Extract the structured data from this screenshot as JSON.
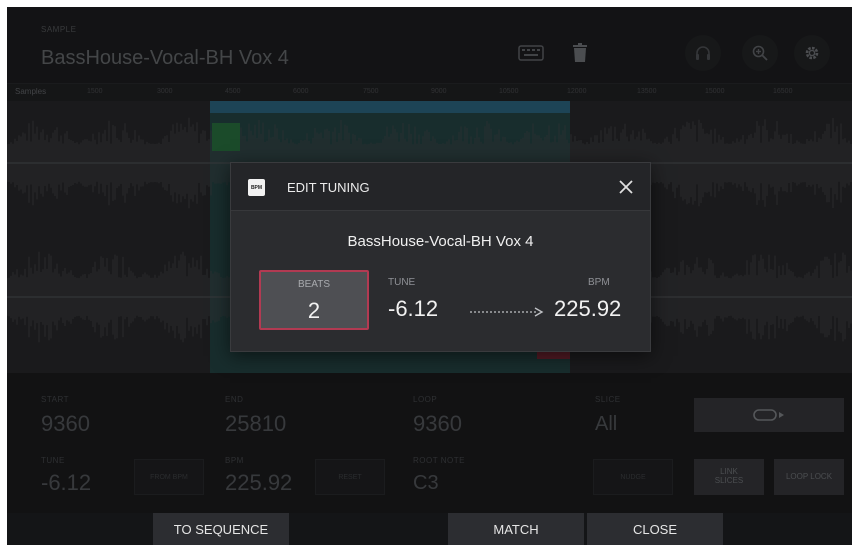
{
  "header": {
    "sample_label": "SAMPLE",
    "sample_name": "BassHouse-Vocal-BH Vox 4",
    "icons": [
      "keyboard-icon",
      "trash-icon",
      "headphones-icon",
      "zoom-icon",
      "gear-icon"
    ]
  },
  "ruler": {
    "mode": "Samples",
    "ticks": [
      "1500",
      "3000",
      "4500",
      "6000",
      "7500",
      "9000",
      "10500",
      "12000",
      "13500",
      "15000",
      "16500"
    ]
  },
  "params": {
    "start": {
      "label": "START",
      "value": "9360"
    },
    "end": {
      "label": "END",
      "value": "25810"
    },
    "loop": {
      "label": "LOOP",
      "value": "9360"
    },
    "slice": {
      "label": "SLICE",
      "value": "All"
    },
    "tune": {
      "label": "TUNE",
      "value": "-6.12"
    },
    "bpm": {
      "label": "BPM",
      "value": "225.92"
    },
    "root_note": {
      "label": "ROOT NOTE",
      "value": "C3"
    },
    "from_bpm_label": "FROM BPM",
    "reset_label": "RESET",
    "nudge_label": "NUDGE",
    "link_slices_label": "LINK SLICES",
    "loop_lock_label": "LOOP LOCK"
  },
  "bottom": {
    "to_sequence": "TO SEQUENCE",
    "match": "MATCH",
    "close": "CLOSE"
  },
  "modal": {
    "badge": "BPM",
    "title": "EDIT TUNING",
    "sample_name": "BassHouse-Vocal-BH Vox 4",
    "beats": {
      "label": "BEATS",
      "value": "2"
    },
    "tune": {
      "label": "TUNE",
      "value": "-6.12"
    },
    "bpm": {
      "label": "BPM",
      "value": "225.92"
    }
  },
  "colors": {
    "accent_red": "#b23a52",
    "selection_teal": "#27504d",
    "start_marker_green": "#2d7a44"
  }
}
